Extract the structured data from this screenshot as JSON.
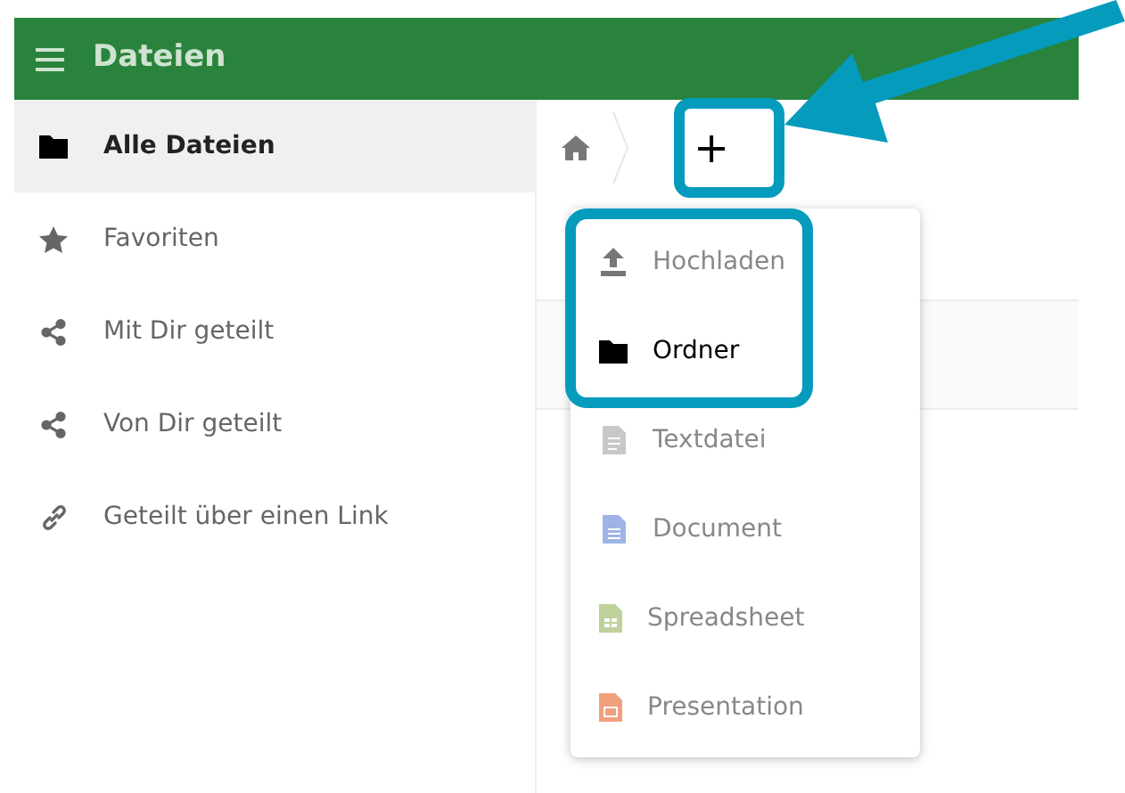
{
  "header": {
    "title": "Dateien"
  },
  "sidebar": {
    "items": [
      {
        "label": "Alle Dateien",
        "kind": "folder",
        "selected": true
      },
      {
        "label": "Favoriten",
        "kind": "star",
        "selected": false
      },
      {
        "label": "Mit Dir geteilt",
        "kind": "share",
        "selected": false
      },
      {
        "label": "Von Dir geteilt",
        "kind": "share",
        "selected": false
      },
      {
        "label": "Geteilt über einen Link",
        "kind": "link",
        "selected": false
      }
    ]
  },
  "breadcrumb": {
    "new_button": "+"
  },
  "new_menu": {
    "items": [
      {
        "label": "Hochladen",
        "kind": "upload",
        "selected": false
      },
      {
        "label": "Ordner",
        "kind": "folder",
        "selected": true
      },
      {
        "label": "Textdatei",
        "kind": "text",
        "selected": false
      },
      {
        "label": "Document",
        "kind": "document",
        "selected": false
      },
      {
        "label": "Spreadsheet",
        "kind": "spreadsheet",
        "selected": false
      },
      {
        "label": "Presentation",
        "kind": "presentation",
        "selected": false
      }
    ]
  }
}
